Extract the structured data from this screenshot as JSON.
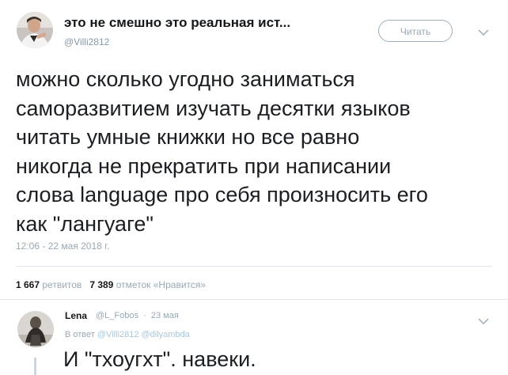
{
  "tweet": {
    "author_name": "это не смешно это реальная ист...",
    "author_handle": "@Villi2812",
    "follow_label": "Читать",
    "text_lines": [
      "можно сколько угодно заниматься",
      "саморазвитием изучать десятки языков",
      "читать умные книжки но все равно",
      "никогда не прекратить при написании",
      "слова language про себя произносить его",
      "как \"лангуаге\""
    ],
    "timestamp": "12:06 - 22 мая 2018 г.",
    "retweets_count": "1 667",
    "retweets_label": "ретвитов",
    "likes_count": "7 389",
    "likes_label": "отметок «Нравится»"
  },
  "reply": {
    "author_name": "Lena",
    "author_handle": "@L_Fobos",
    "date": "23 мая",
    "reply_prefix": "В ответ",
    "reply_handles": "@Villi2812 @dilyambda",
    "text": "И \"тхоугхт\". навеки."
  },
  "icons": {
    "more_menu": "chevron-down-icon"
  },
  "colors": {
    "muted_text": "#9aa8b3",
    "divider": "#e1e8ed",
    "link": "#a9c6dc"
  }
}
